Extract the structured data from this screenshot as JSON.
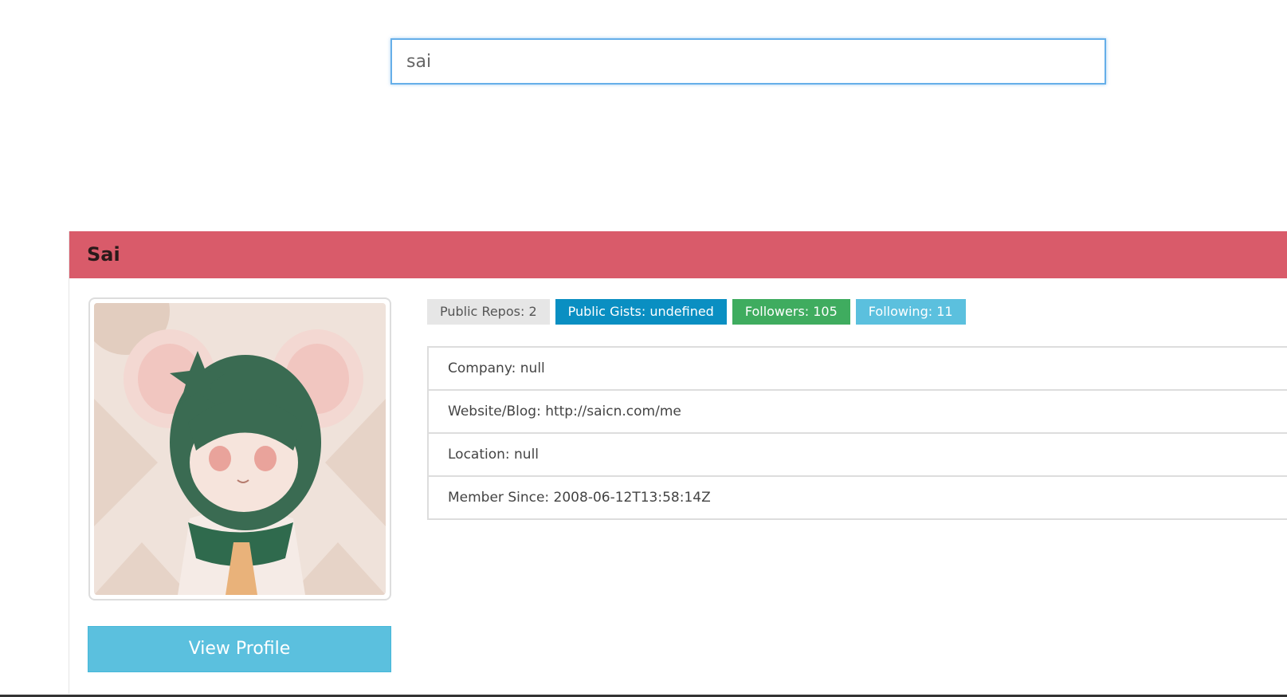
{
  "search": {
    "value": "sai"
  },
  "profile": {
    "name": "Sai",
    "view_profile_label": "View Profile",
    "badges": {
      "public_repos": "Public Repos: 2",
      "public_gists": "Public Gists: undefined",
      "followers": "Followers: 105",
      "following": "Following: 11"
    },
    "details": {
      "company": "Company: null",
      "website": "Website/Blog: http://saicn.com/me",
      "location": "Location: null",
      "member_since": "Member Since: 2008-06-12T13:58:14Z"
    }
  },
  "colors": {
    "heading_bg": "#d95b6a",
    "search_focus_border": "#66afe9",
    "button_bg": "#5bc0de",
    "badge_default": "#e6e6e6",
    "badge_primary": "#0a8fc2",
    "badge_success": "#3fac5f",
    "badge_info": "#5bc0de"
  }
}
